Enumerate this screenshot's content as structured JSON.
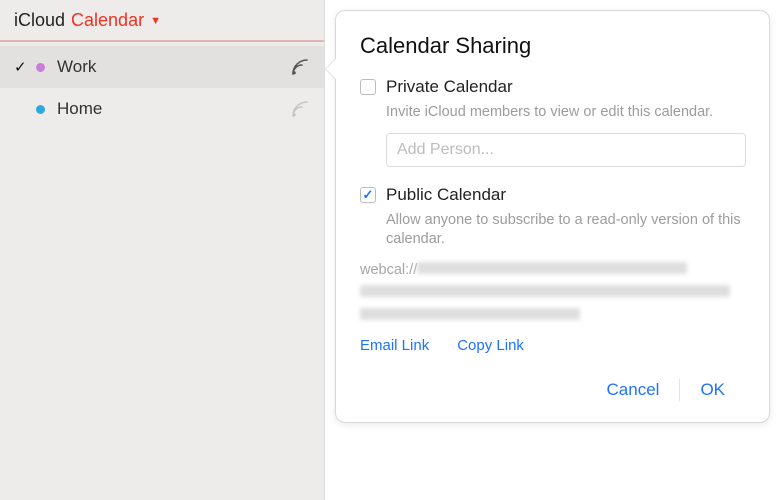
{
  "header": {
    "brand": "iCloud",
    "app": "Calendar"
  },
  "calendars": [
    {
      "label": "Work",
      "color": "#c97dd6",
      "selected": true,
      "checked": true,
      "sharing": true
    },
    {
      "label": "Home",
      "color": "#2aa9e0",
      "selected": false,
      "checked": false,
      "sharing": false
    }
  ],
  "popover": {
    "title": "Calendar Sharing",
    "private": {
      "label": "Private Calendar",
      "desc": "Invite iCloud members to view or edit this calendar.",
      "placeholder": "Add Person...",
      "checked": false
    },
    "public": {
      "label": "Public Calendar",
      "desc": "Allow anyone to subscribe to a read-only version of this calendar.",
      "url_prefix": "webcal://",
      "checked": true
    },
    "links": {
      "email": "Email Link",
      "copy": "Copy Link"
    },
    "buttons": {
      "cancel": "Cancel",
      "ok": "OK"
    }
  }
}
